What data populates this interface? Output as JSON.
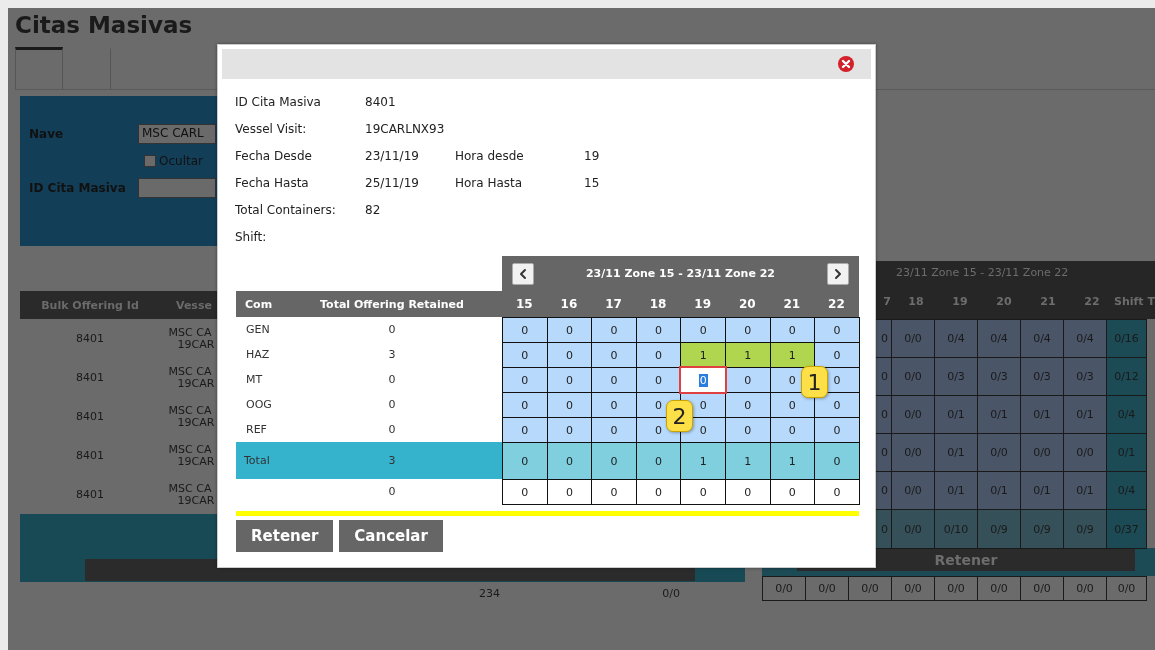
{
  "page": {
    "title": "Citas Masivas",
    "tabs": [
      {
        "selected": true
      },
      {
        "selected": false
      }
    ],
    "filters": {
      "nave_label": "Nave",
      "nave_value": "MSC CARL",
      "hide_label": "Ocultar",
      "hide_checked": false,
      "id_label": "ID Cita Masiva"
    },
    "table": {
      "columns": [
        "Bulk Offering Id",
        "Vesse"
      ],
      "rows": [
        {
          "id": "8401",
          "vessel": [
            "MSC CA",
            "19CAR"
          ]
        },
        {
          "id": "8401",
          "vessel": [
            "MSC CA",
            "19CAR"
          ]
        },
        {
          "id": "8401",
          "vessel": [
            "MSC CA",
            "19CAR"
          ]
        },
        {
          "id": "8401",
          "vessel": [
            "MSC CA",
            "19CAR"
          ]
        },
        {
          "id": "8401",
          "vessel": [
            "MSC CA",
            "19CAR"
          ]
        }
      ],
      "footer": [
        "234",
        "0/0"
      ]
    },
    "grid": {
      "title": "23/11 Zone 15 - 23/11 Zone 22",
      "columns": [
        "7",
        "18",
        "19",
        "20",
        "21",
        "22",
        "Shift T"
      ],
      "rows": [
        [
          "0",
          "0/0",
          "0/4",
          "0/4",
          "0/4",
          "0/4",
          "0/16"
        ],
        [
          "0",
          "0/0",
          "0/3",
          "0/3",
          "0/3",
          "0/3",
          "0/12"
        ],
        [
          "0",
          "0/0",
          "0/1",
          "0/1",
          "0/1",
          "0/1",
          "0/4"
        ],
        [
          "0",
          "0/0",
          "0/1",
          "0/0",
          "0/0",
          "0/0",
          "0/1"
        ],
        [
          "0",
          "0/0",
          "0/1",
          "0/1",
          "0/1",
          "0/1",
          "0/4"
        ]
      ],
      "total": [
        "0",
        "0/0",
        "0/10",
        "0/9",
        "0/9",
        "0/9",
        "0/37"
      ],
      "button": "Retener",
      "bottom": [
        "0/0",
        "0/0",
        "0/0",
        "0/0",
        "0/0",
        "0/0",
        "0/0",
        "0/0",
        "0/0"
      ]
    }
  },
  "modal": {
    "info": [
      {
        "label": "ID Cita Masiva",
        "value": "8401"
      },
      {
        "label": "Vessel Visit:",
        "value": "19CARLNX93"
      },
      {
        "label": "Fecha Desde",
        "value": "23/11/19",
        "label2": "Hora desde",
        "value2": "19"
      },
      {
        "label": "Fecha Hasta",
        "value": "25/11/19",
        "label2": "Hora Hasta",
        "value2": "15"
      },
      {
        "label": "Total Containers:",
        "value": "82"
      },
      {
        "label": "Shift:"
      }
    ],
    "grid": {
      "range": "23/11 Zone 15 - 23/11 Zone 22",
      "headers": [
        "Com",
        "Total Offering Retained"
      ],
      "hours": [
        "15",
        "16",
        "17",
        "18",
        "19",
        "20",
        "21",
        "22"
      ],
      "rows": [
        {
          "com": "GEN",
          "total": "0",
          "cells": [
            {
              "value": "0",
              "highlighted": false,
              "selected": false
            },
            {
              "value": "0",
              "highlighted": false,
              "selected": false
            },
            {
              "value": "0",
              "highlighted": false,
              "selected": false
            },
            {
              "value": "0",
              "highlighted": false,
              "selected": false
            },
            {
              "value": "0",
              "highlighted": false,
              "selected": false
            },
            {
              "value": "0",
              "highlighted": false,
              "selected": false
            },
            {
              "value": "0",
              "highlighted": false,
              "selected": false
            },
            {
              "value": "0",
              "highlighted": false,
              "selected": false
            }
          ]
        },
        {
          "com": "HAZ",
          "total": "3",
          "cells": [
            {
              "value": "0",
              "highlighted": false,
              "selected": false
            },
            {
              "value": "0",
              "highlighted": false,
              "selected": false
            },
            {
              "value": "0",
              "highlighted": false,
              "selected": false
            },
            {
              "value": "0",
              "highlighted": false,
              "selected": false
            },
            {
              "value": "1",
              "highlighted": true,
              "selected": false
            },
            {
              "value": "1",
              "highlighted": true,
              "selected": false
            },
            {
              "value": "1",
              "highlighted": true,
              "selected": false
            },
            {
              "value": "0",
              "highlighted": false,
              "selected": false
            }
          ]
        },
        {
          "com": "MT",
          "total": "0",
          "cells": [
            {
              "value": "0",
              "highlighted": false,
              "selected": false
            },
            {
              "value": "0",
              "highlighted": false,
              "selected": false
            },
            {
              "value": "0",
              "highlighted": false,
              "selected": false
            },
            {
              "value": "0",
              "highlighted": false,
              "selected": false
            },
            {
              "value": "0",
              "highlighted": false,
              "selected": true
            },
            {
              "value": "0",
              "highlighted": false,
              "selected": false
            },
            {
              "value": "0",
              "highlighted": false,
              "selected": false
            },
            {
              "value": "0",
              "highlighted": false,
              "selected": false
            }
          ]
        },
        {
          "com": "OOG",
          "total": "0",
          "cells": [
            {
              "value": "0",
              "highlighted": false,
              "selected": false
            },
            {
              "value": "0",
              "highlighted": false,
              "selected": false
            },
            {
              "value": "0",
              "highlighted": false,
              "selected": false
            },
            {
              "value": "0",
              "highlighted": false,
              "selected": false
            },
            {
              "value": "0",
              "highlighted": false,
              "selected": false
            },
            {
              "value": "0",
              "highlighted": false,
              "selected": false
            },
            {
              "value": "0",
              "highlighted": false,
              "selected": false
            },
            {
              "value": "0",
              "highlighted": false,
              "selected": false
            }
          ]
        },
        {
          "com": "REF",
          "total": "0",
          "cells": [
            {
              "value": "0",
              "highlighted": false,
              "selected": false
            },
            {
              "value": "0",
              "highlighted": false,
              "selected": false
            },
            {
              "value": "0",
              "highlighted": false,
              "selected": false
            },
            {
              "value": "0",
              "highlighted": false,
              "selected": false
            },
            {
              "value": "0",
              "highlighted": false,
              "selected": false
            },
            {
              "value": "0",
              "highlighted": false,
              "selected": false
            },
            {
              "value": "0",
              "highlighted": false,
              "selected": false
            },
            {
              "value": "0",
              "highlighted": false,
              "selected": false
            }
          ]
        }
      ],
      "total_row": {
        "label": "Total",
        "total": "3",
        "cells": [
          "0",
          "0",
          "0",
          "0",
          "1",
          "1",
          "1",
          "0"
        ]
      },
      "extra_row": {
        "total": "0",
        "cells": [
          "0",
          "0",
          "0",
          "0",
          "0",
          "0",
          "0",
          "0"
        ]
      }
    },
    "buttons": [
      "Retener",
      "Cancelar"
    ],
    "callouts": [
      "1",
      "2"
    ]
  }
}
